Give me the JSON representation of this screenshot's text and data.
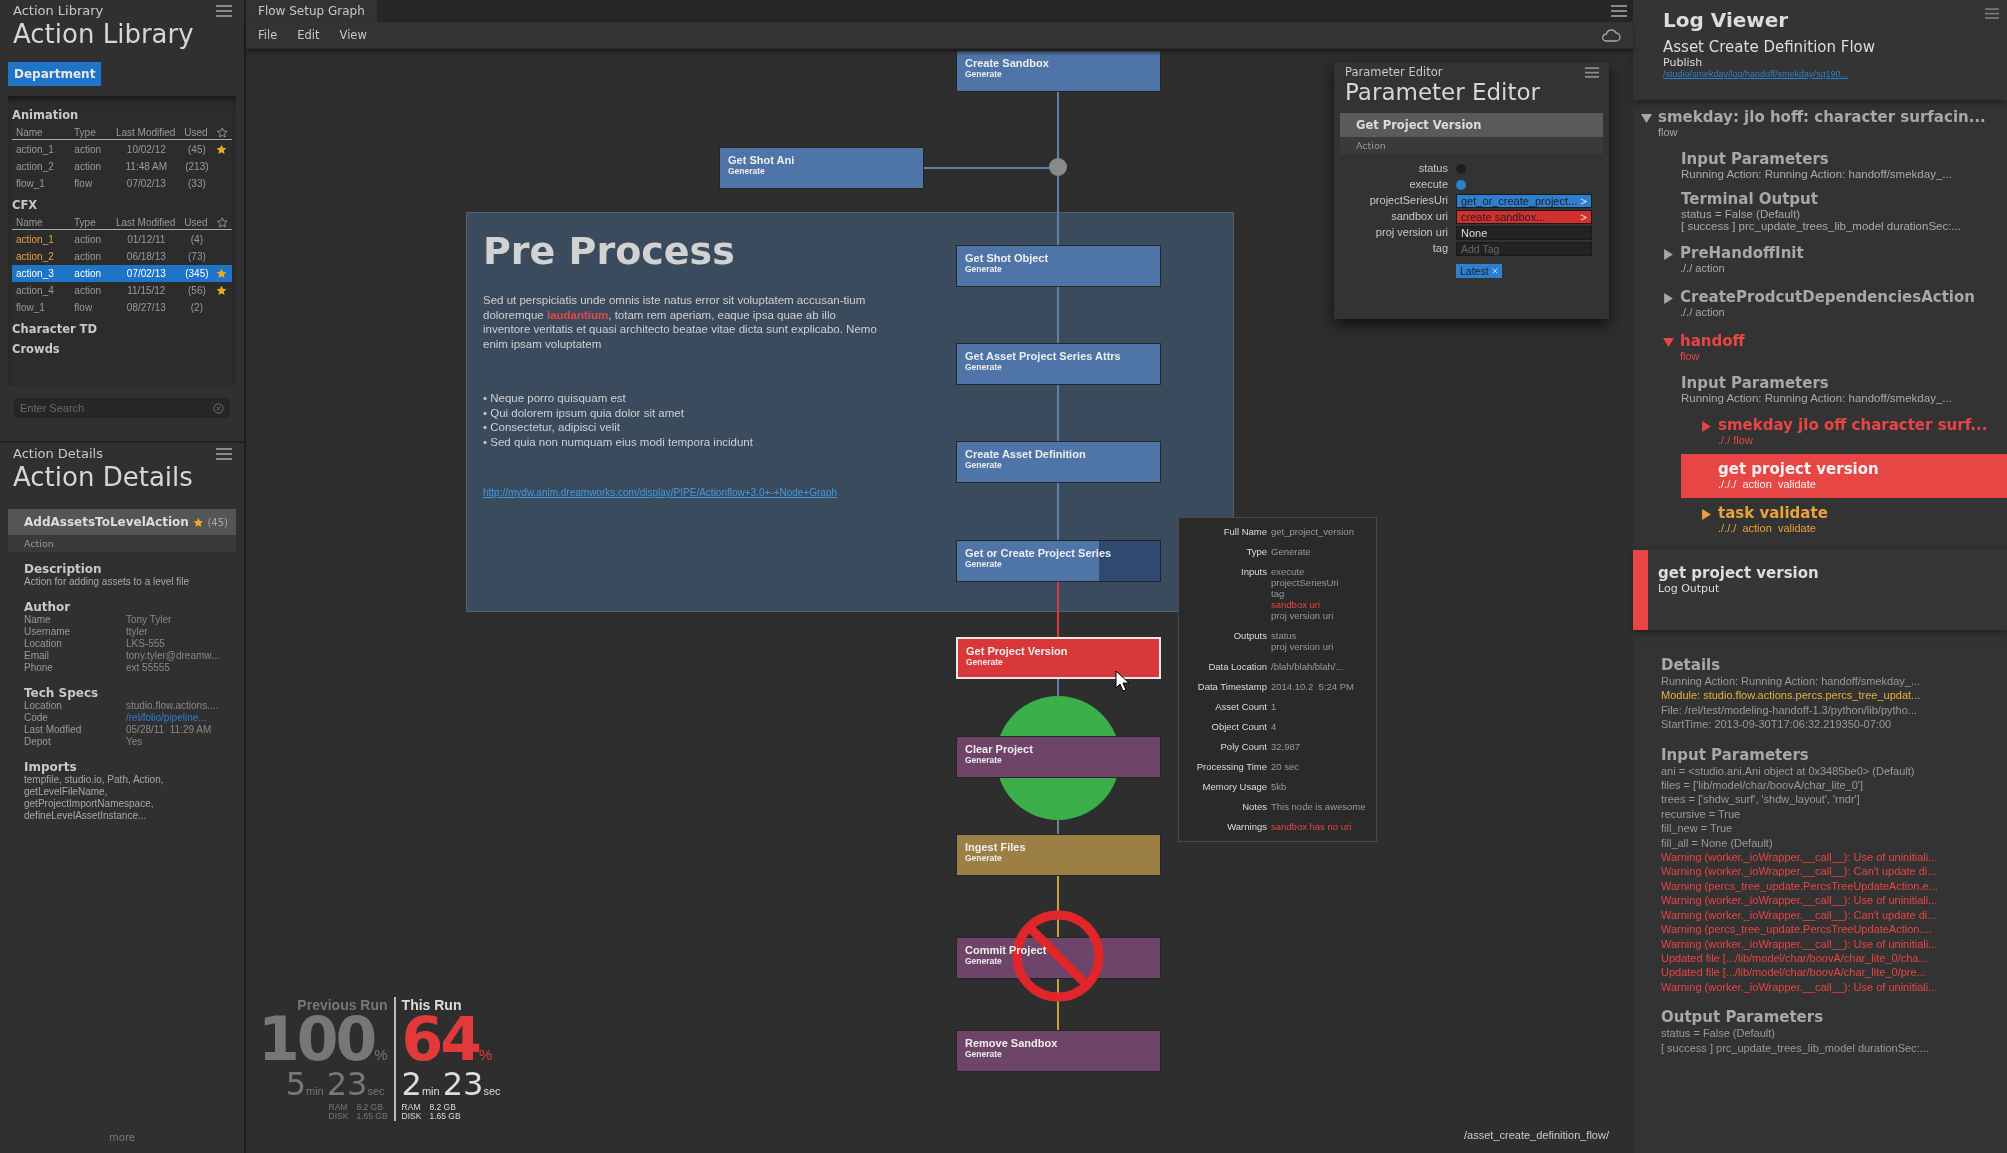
{
  "action_library": {
    "panel_title": "Action Library",
    "title": "Action Library",
    "filter_button": "Department",
    "groups": [
      {
        "name": "Animation",
        "columns": [
          "Name",
          "Type",
          "Last Modified",
          "Used"
        ],
        "rows": [
          {
            "name": "action_1",
            "type": "action",
            "modified": "10/02/12",
            "used": "(45)",
            "starred": true,
            "selected": false,
            "highlighted": false
          },
          {
            "name": "action_2",
            "type": "action",
            "modified": "11:48 AM",
            "used": "(213)",
            "starred": false,
            "selected": false,
            "highlighted": false
          },
          {
            "name": "flow_1",
            "type": "flow",
            "modified": "07/02/13",
            "used": "(33)",
            "starred": false,
            "selected": false,
            "highlighted": false
          }
        ]
      },
      {
        "name": "CFX",
        "columns": [
          "Name",
          "Type",
          "Last Modified",
          "Used"
        ],
        "rows": [
          {
            "name": "action_1",
            "type": "action",
            "modified": "01/12/11",
            "used": "(4)",
            "starred": false,
            "selected": false,
            "highlighted": true
          },
          {
            "name": "action_2",
            "type": "action",
            "modified": "06/18/13",
            "used": "(73)",
            "starred": false,
            "selected": false,
            "highlighted": true
          },
          {
            "name": "action_3",
            "type": "action",
            "modified": "07/02/13",
            "used": "(345)",
            "starred": true,
            "selected": true,
            "highlighted": false
          },
          {
            "name": "action_4",
            "type": "action",
            "modified": "11/15/12",
            "used": "(56)",
            "starred": true,
            "selected": false,
            "highlighted": false
          },
          {
            "name": "flow_1",
            "type": "flow",
            "modified": "08/27/13",
            "used": "(2)",
            "starred": false,
            "selected": false,
            "highlighted": false
          }
        ]
      },
      {
        "name": "Character TD"
      },
      {
        "name": "Crowds"
      }
    ],
    "search": {
      "placeholder": "Enter Search"
    }
  },
  "action_details": {
    "panel_title": "Action Details",
    "title": "Action Details",
    "card": {
      "name": "AddAssetsToLevelAction",
      "starred": true,
      "count": "(45)",
      "type": "Action"
    },
    "sections": [
      {
        "heading": "Description",
        "lines": [
          "Action for adding assets to a level file"
        ]
      },
      {
        "heading": "Author",
        "fields": [
          {
            "label": "Name",
            "value": "Tony Tyler",
            "kind": "text"
          },
          {
            "label": "Username",
            "value": "ttyler",
            "kind": "text"
          },
          {
            "label": "Location",
            "value": "LKS-555",
            "kind": "text"
          },
          {
            "label": "Email",
            "value": "tony.tyler@dreamw...",
            "kind": "text"
          },
          {
            "label": "Phone",
            "value": "ext 55555",
            "kind": "text"
          }
        ]
      },
      {
        "heading": "Tech Specs",
        "fields": [
          {
            "label": "Location",
            "value": "studio.flow.actions....",
            "kind": "text"
          },
          {
            "label": "Code",
            "value": "/rel/folio/pipeline...",
            "kind": "link"
          },
          {
            "label": "Last Modfied",
            "value": "05/28/11  11:29 AM",
            "kind": "text"
          },
          {
            "label": "Depot",
            "value": "Yes",
            "kind": "text"
          }
        ]
      },
      {
        "heading": "Imports",
        "lines": [
          "tempfile, studio.io, Path, Action,",
          "getLevelFileName,",
          "getProjectImportNamespace,",
          "defineLevelAssetInstance..."
        ]
      }
    ],
    "more": "more"
  },
  "graph": {
    "tab": "Flow Setup Graph",
    "menu": [
      "File",
      "Edit",
      "View"
    ],
    "note": {
      "title": "Pre Process",
      "paragraph": "Sed ut perspiciatis unde omnis iste natus error sit voluptatem accusan-tium doloremque **laudantium**, totam rem aperiam, eaque ipsa quae ab illo inventore veritatis et quasi architecto beatae vitae dicta sunt explicabo. Nemo enim ipsam voluptatem",
      "bullets": [
        "• Neque porro quisquam est",
        "• Qui dolorem ipsum quia dolor sit amet",
        "• Consectetur, adipisci velit",
        "• Sed quia non numquam eius modi tempora incidunt"
      ],
      "link": "http://mydw.anim.dreamworks.com/display/PIPE/Actionflow+3.0+-+Node+Graph"
    },
    "nodes": [
      {
        "name": "Create Sandbox",
        "type": "Generate",
        "color": "#4f75a8",
        "selected": false
      },
      {
        "name": "Get Shot Ani",
        "type": "Generate",
        "color": "#4f75a8",
        "selected": false
      },
      {
        "name": "Get Shot Object",
        "type": "Generate",
        "color": "#4f75a8",
        "selected": false
      },
      {
        "name": "Get Asset Project Series Attrs",
        "type": "Generate",
        "color": "#4f75a8",
        "selected": false
      },
      {
        "name": "Create Asset Definition",
        "type": "Generate",
        "color": "#4f75a8",
        "selected": false
      },
      {
        "name": "Get or Create Project Series",
        "type": "Generate",
        "color": "#4f75a8",
        "selected": false,
        "level": 0.7
      },
      {
        "name": "Get Project Version",
        "type": "Generate",
        "color": "#d8383a",
        "selected": true
      },
      {
        "name": "Clear Project",
        "type": "Generate",
        "color": "#6e4468",
        "selected": false
      },
      {
        "name": "Ingest Files",
        "type": "Generate",
        "color": "#9c7f45",
        "selected": false
      },
      {
        "name": "Commit Project",
        "type": "Generate",
        "color": "#6e4468",
        "selected": false
      },
      {
        "name": "Remove Sandbox",
        "type": "Generate",
        "color": "#6e4468",
        "selected": false
      }
    ],
    "parameter_editor": {
      "panel_title": "Parameter Editor",
      "title": "Parameter Editor",
      "node": "Get Project Version",
      "type": "Action",
      "params": [
        {
          "label": "status",
          "kind": "toggle",
          "on": false
        },
        {
          "label": "execute",
          "kind": "toggle",
          "on": true
        },
        {
          "label": "projectSeriesUri",
          "kind": "link",
          "value": "get_or_create_project...",
          "color": "#2d7fd0"
        },
        {
          "label": "sandbox uri",
          "kind": "link",
          "value": "create sandbox...",
          "color": "#d32f2f"
        },
        {
          "label": "proj version uri",
          "kind": "text",
          "value": "None"
        },
        {
          "label": "tag",
          "kind": "tag",
          "placeholder": "Add Tag",
          "tags": [
            "Latest"
          ]
        }
      ]
    },
    "info": [
      {
        "label": "Full Name",
        "lines": [
          {
            "text": "get_project_version",
            "error": false
          }
        ]
      },
      {
        "label": "Type",
        "lines": [
          {
            "text": "Generate",
            "error": false
          }
        ]
      },
      {
        "label": "Inputs",
        "lines": [
          {
            "text": "execute",
            "error": false
          },
          {
            "text": "projectSeriesUri",
            "error": false
          },
          {
            "text": "tag",
            "error": false
          },
          {
            "text": "sandbox uri",
            "error": true
          },
          {
            "text": "proj version uri",
            "error": false
          }
        ]
      },
      {
        "label": "Outputs",
        "lines": [
          {
            "text": "status",
            "error": false
          },
          {
            "text": "proj version uri",
            "error": false
          }
        ]
      },
      {
        "label": "Data Location",
        "lines": [
          {
            "text": "/blah/blah/blah/...",
            "error": false
          }
        ]
      },
      {
        "label": "Data Timestamp",
        "lines": [
          {
            "text": "2014.10.2  5:24 PM",
            "error": false
          }
        ]
      },
      {
        "label": "Asset Count",
        "lines": [
          {
            "text": "1",
            "error": false
          }
        ]
      },
      {
        "label": "Object Count",
        "lines": [
          {
            "text": "4",
            "error": false
          }
        ]
      },
      {
        "label": "Poly Count",
        "lines": [
          {
            "text": "32,987",
            "error": false
          }
        ]
      },
      {
        "label": "Processing Time",
        "lines": [
          {
            "text": "20 sec",
            "error": false
          }
        ]
      },
      {
        "label": "Memory Usage",
        "lines": [
          {
            "text": "5kb",
            "error": false
          }
        ]
      },
      {
        "label": "Notes",
        "lines": [
          {
            "text": "This node is awesome",
            "error": false
          }
        ]
      },
      {
        "label": "Warnings",
        "lines": [
          {
            "text": "sandbox has no uri",
            "error": true
          }
        ]
      }
    ],
    "runs": [
      {
        "label": "Previous Run",
        "current": false,
        "percent": "100",
        "percent_unit": "%",
        "minutes": "5",
        "min_unit": "min",
        "seconds": "23",
        "sec_unit": "sec",
        "ram_label": "RAM",
        "ram": "8.2 GB",
        "disk_label": "DISK",
        "disk": "1.65 GB"
      },
      {
        "label": "This Run",
        "current": true,
        "percent": "64",
        "percent_unit": "%",
        "minutes": "2",
        "min_unit": "min",
        "seconds": "23",
        "sec_unit": "sec",
        "ram_label": "RAM",
        "ram": "8.2 GB",
        "disk_label": "DISK",
        "disk": "1.65 GB"
      }
    ],
    "path": "/asset_create_definition_flow/"
  },
  "log_viewer": {
    "title": "Log Viewer",
    "flow": "Asset Create Definition Flow",
    "subtitle": "Publish",
    "path": "/studio/smekday/log/handoff/smekday/sq190...",
    "tree": [
      {
        "kind": "node",
        "name": "smekday: jlo hoff: character surfacin...",
        "meta": "flow",
        "color": "#a8a8a8",
        "expanded": true,
        "selected": false,
        "children": [
          {
            "kind": "section",
            "name": "Input Parameters",
            "lines": [
              "Running Action: Running Action: handoff/smekday_..."
            ]
          },
          {
            "kind": "section",
            "name": "Terminal Output",
            "lines": [
              "status = False (Default)",
              "[ success ] prc_update_trees_lib_model durationSec:..."
            ]
          },
          {
            "kind": "node",
            "name": "PreHandoffInit",
            "meta": "././ action",
            "color": "#a8a8a8",
            "expanded": false,
            "selected": false
          },
          {
            "kind": "node",
            "name": "CreateProdcutDependenciesAction",
            "meta": "././ action",
            "color": "#a8a8a8",
            "expanded": false,
            "selected": false
          },
          {
            "kind": "node",
            "name": "handoff",
            "meta": "flow",
            "color": "#e84545",
            "expanded": true,
            "selected": false,
            "children": [
              {
                "kind": "section",
                "name": "Input Parameters",
                "lines": [
                  "Running Action: Running Action: handoff/smekday_..."
                ]
              },
              {
                "kind": "node",
                "name": "smekday jlo off character surf...",
                "meta": "././ flow",
                "color": "#e84545",
                "expanded": false,
                "selected": false
              },
              {
                "kind": "node",
                "name": "get project version",
                "meta": "./././  action  validate",
                "color": "#e84545",
                "selected": true
              },
              {
                "kind": "node",
                "name": "task validate",
                "meta": "./././  action  validate",
                "color": "#e8a33c",
                "expanded": false,
                "selected": false
              }
            ]
          }
        ]
      }
    ],
    "detail": {
      "name": "get project version",
      "subtitle": "Log Output",
      "color": "#e84545"
    },
    "sections": [
      {
        "heading": "Details",
        "lines": [
          {
            "text": "Running Action: Running Action: handoff/smekday_...",
            "kind": "info"
          },
          {
            "text": "Module: studio.flow.actions.percs.percs_tree_updat...",
            "kind": "warning"
          },
          {
            "text": "File: /rel/test/modeling-handoff-1.3/python/lib/pytho...",
            "kind": "info"
          },
          {
            "text": "StartTime: 2013-09-30T17:06:32.219350-07:00",
            "kind": "info"
          }
        ]
      },
      {
        "heading": "Input Parameters",
        "lines": [
          {
            "text": "ani = <studio.ani.Ani object at 0x3485be0> (Default)",
            "kind": "info"
          },
          {
            "text": "files = ['lib/model/char/boovA/char_lite_0']",
            "kind": "info"
          },
          {
            "text": "trees = ['shdw_surf', 'shdw_layout', 'rndr']",
            "kind": "info"
          },
          {
            "text": "recursive = True",
            "kind": "info"
          },
          {
            "text": "fill_new = True",
            "kind": "info"
          },
          {
            "text": "fill_all = None (Default)",
            "kind": "info"
          },
          {
            "text": "Warning (worker._ioWrapper.__call__): Use of uninitiali...",
            "kind": "error"
          },
          {
            "text": "Warning (worker._ioWrapper.__call__): Can't update di...",
            "kind": "error"
          },
          {
            "text": "Warning (percs_tree_update.PercsTreeUpdateAction.e...",
            "kind": "error"
          },
          {
            "text": "Warning (worker._ioWrapper.__call__): Use of uninitiali...",
            "kind": "error"
          },
          {
            "text": "Warning (worker._ioWrapper.__call__): Can't update di...",
            "kind": "error"
          },
          {
            "text": "Warning (percs_tree_update.PercsTreeUpdateAction....",
            "kind": "error"
          },
          {
            "text": "Warning (worker._ioWrapper.__call__): Use of uninitiali...",
            "kind": "error"
          },
          {
            "text": "Updated file [.../lib/model/char/boovA/char_lite_0/cha...",
            "kind": "error"
          },
          {
            "text": "Updated file [.../lib/model/char/boovA/char_lite_0/pre...",
            "kind": "error"
          },
          {
            "text": "Warning (worker._ioWrapper.__call__): Use of uninitiali...",
            "kind": "error"
          }
        ]
      },
      {
        "heading": "Output Parameters",
        "lines": [
          {
            "text": "status = False (Default)",
            "kind": "info"
          },
          {
            "text": "[ success ] prc_update_trees_lib_model durationSec:...",
            "kind": "info"
          }
        ]
      }
    ]
  }
}
